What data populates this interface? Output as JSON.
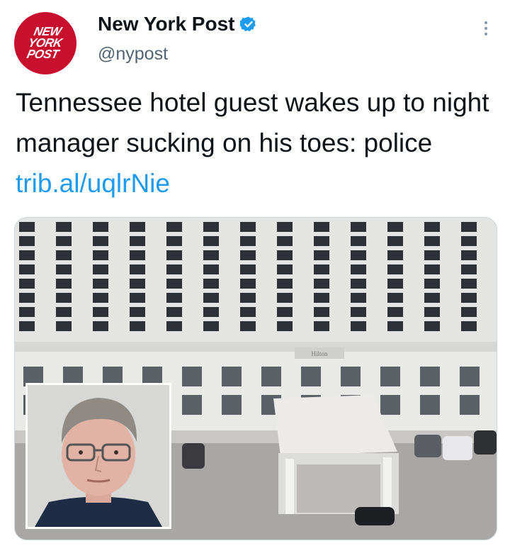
{
  "author": {
    "logo_lines": [
      "NEW",
      "YORK",
      "POST"
    ],
    "display_name": "New York Post",
    "handle": "@nypost",
    "verified": true,
    "icons": {
      "verified": "verified-badge-icon",
      "more": "more-options-icon"
    }
  },
  "tweet": {
    "text": "Tennessee hotel guest wakes up to night manager sucking on his toes: police",
    "link": "trib.al/uqlrNie"
  },
  "media": {
    "sign_text": "Hilton"
  },
  "colors": {
    "brand_red": "#c8102e",
    "link_blue": "#1d9bf0",
    "verified_blue": "#1d9bf0"
  }
}
